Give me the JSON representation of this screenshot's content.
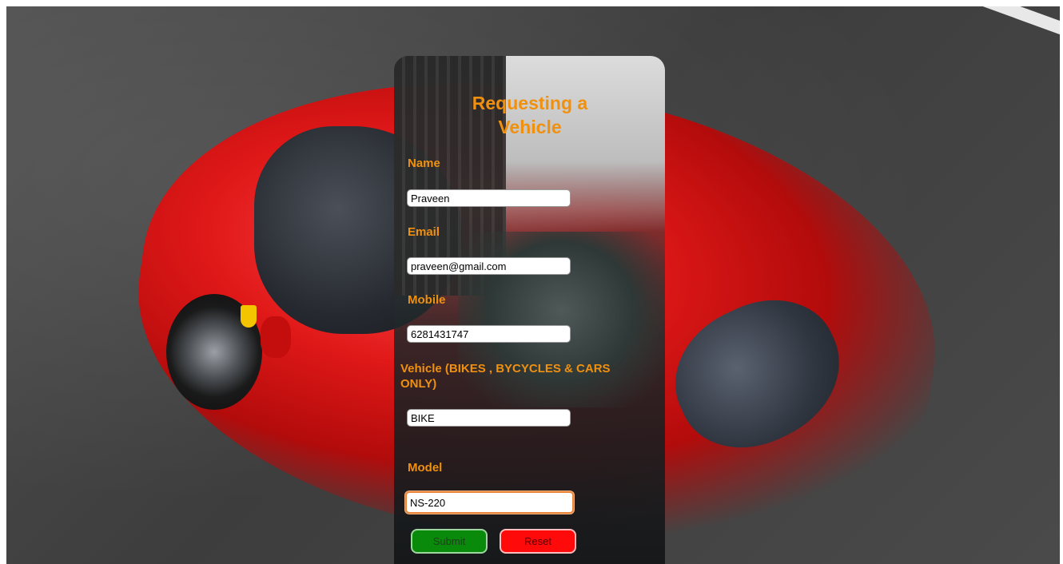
{
  "form": {
    "title_line1": "Requesting a",
    "title_line2": "Vehicle",
    "name_label": "Name",
    "name_value": "Praveen",
    "email_label": "Email",
    "email_value": "praveen@gmail.com",
    "mobile_label": "Mobile",
    "mobile_value": "6281431747",
    "vehicle_label": "Vehicle (BIKES , BYCYCLES &   CARS ONLY)",
    "vehicle_value": "BIKE",
    "model_label": "Model",
    "model_value": "NS-220",
    "submit_label": "Submit",
    "reset_label": "Reset"
  },
  "colors": {
    "label": "#f0900f",
    "submit": "#0a8a0a",
    "reset": "#ff0a0a"
  }
}
